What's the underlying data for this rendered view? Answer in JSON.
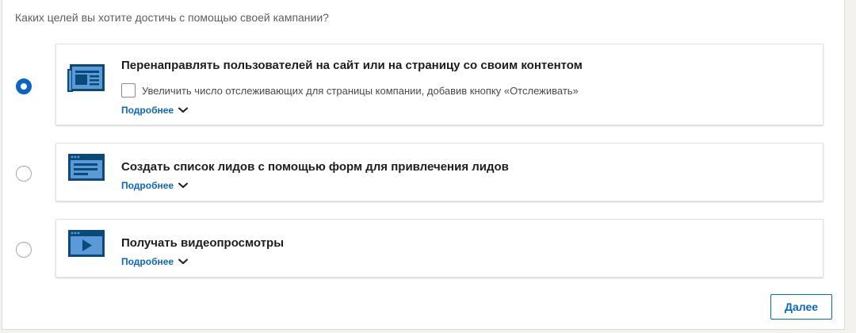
{
  "question": "Каких целей вы хотите достичь с помощью своей кампании?",
  "options": [
    {
      "title": "Перенаправлять пользователей на сайт или на страницу со своим контентом",
      "checkbox_label": "Увеличить число отслеживающих для страницы компании, добавив кнопку «Отслеживать»",
      "more": "Подробнее",
      "icon": "website-visits-icon",
      "selected": true
    },
    {
      "title": "Создать список лидов с помощью форм для привлечения лидов",
      "more": "Подробнее",
      "icon": "lead-form-icon",
      "selected": false
    },
    {
      "title": "Получать видеопросмотры",
      "more": "Подробнее",
      "icon": "video-views-icon",
      "selected": false
    }
  ],
  "next_label": "Далее",
  "colors": {
    "accent": "#0a66c2",
    "icon_dark": "#0b4a78",
    "icon_light": "#5b9ad6"
  }
}
